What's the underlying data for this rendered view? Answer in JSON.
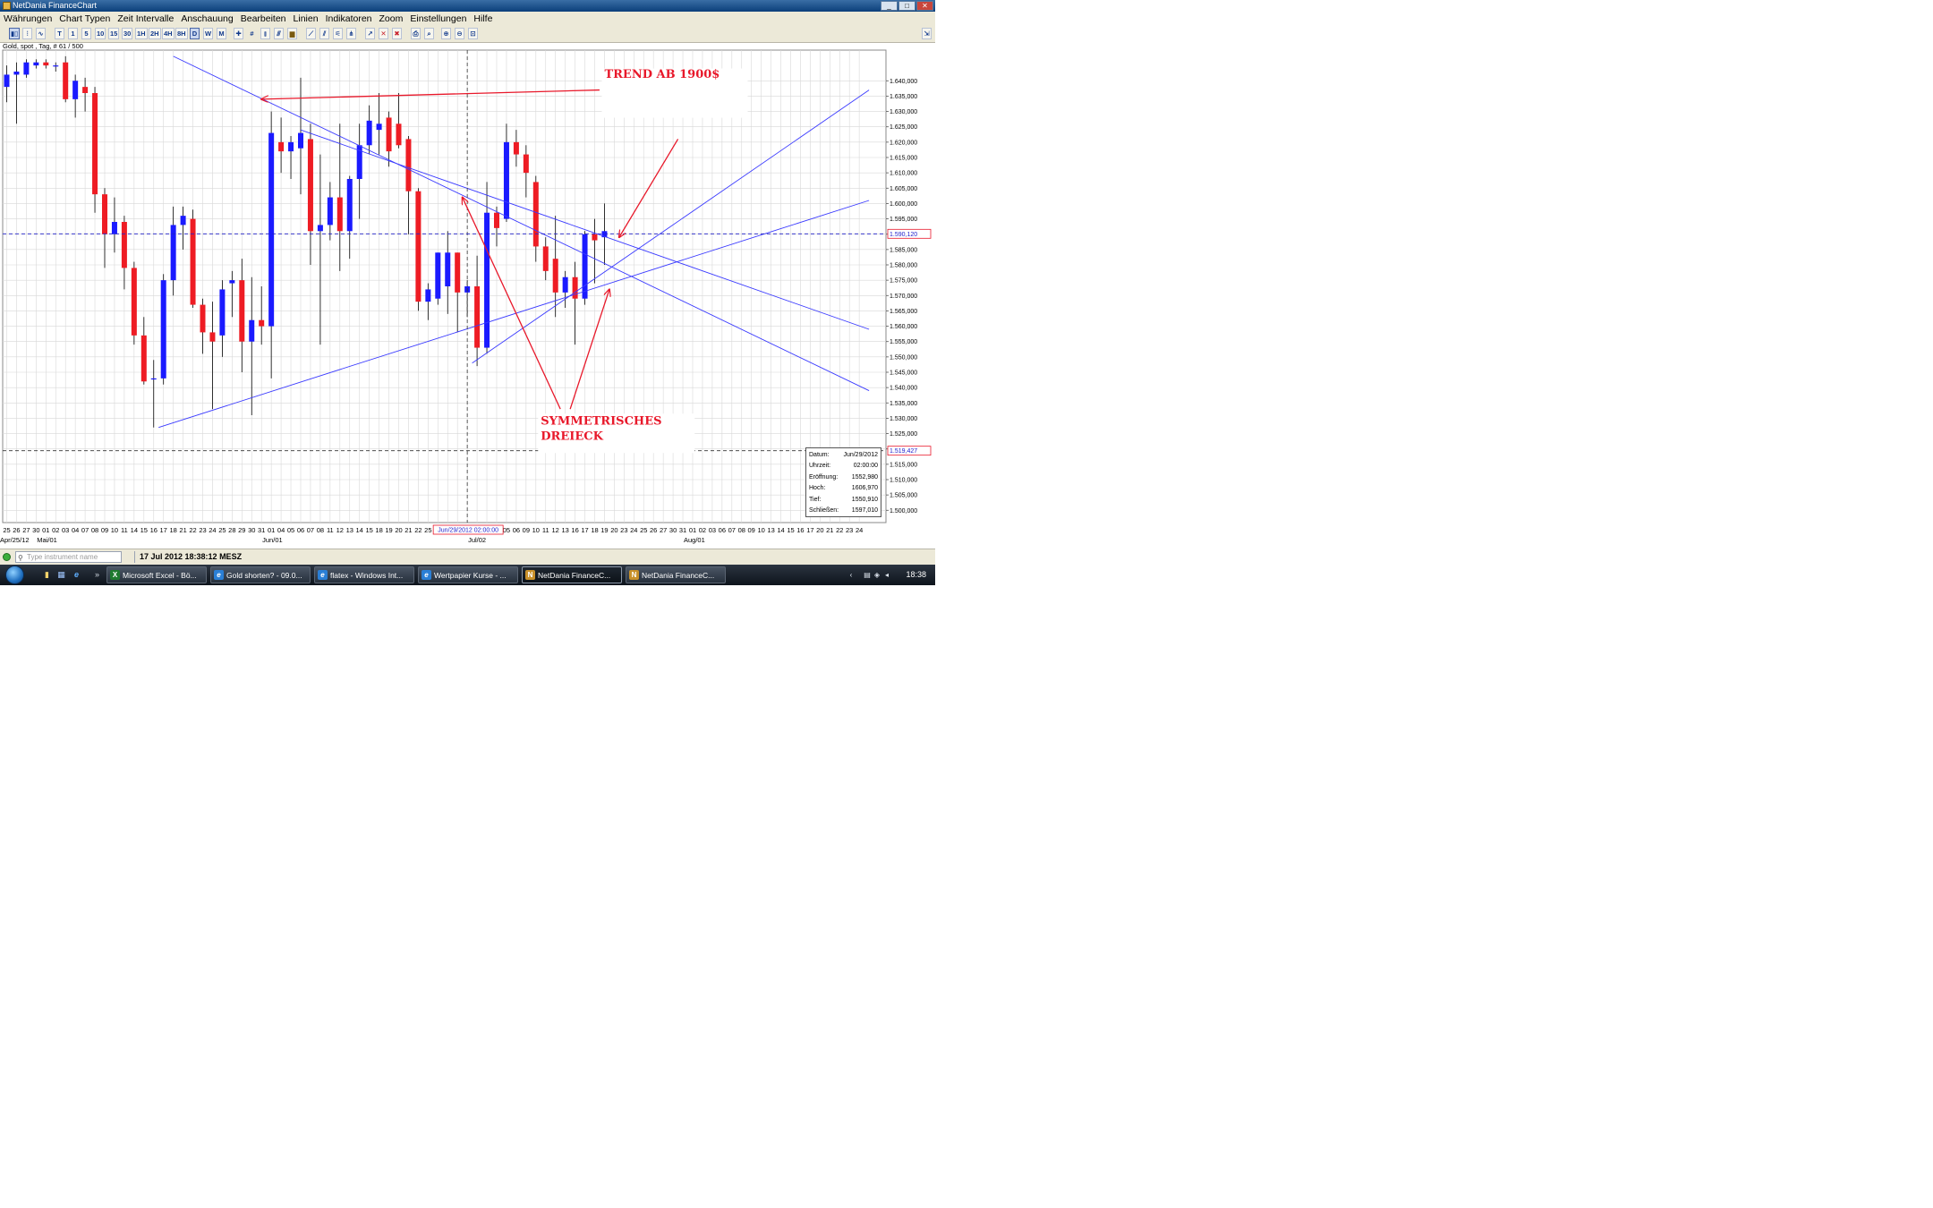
{
  "window": {
    "title": "NetDania FinanceChart",
    "buttons": [
      "_",
      "□",
      "✕"
    ]
  },
  "menu": [
    "Währungen",
    "Chart Typen",
    "Zeit Intervalle",
    "Anschauung",
    "Bearbeiten",
    "Linien",
    "Indikatoren",
    "Zoom",
    "Einstellungen",
    "Hilfe"
  ],
  "toolbar": {
    "intervals": [
      "T",
      "1",
      "5",
      "10",
      "15",
      "30",
      "1H",
      "2H",
      "4H",
      "8H",
      "D",
      "W",
      "M"
    ],
    "selected_interval": "D"
  },
  "instrument": {
    "label": "Gold, spot , Tag, # 61 / 500"
  },
  "chart_data": {
    "type": "candlestick",
    "ylim": [
      1496,
      1650
    ],
    "y_ticks": [
      "1.640,000",
      "1.635,000",
      "1.630,000",
      "1.625,000",
      "1.620,000",
      "1.615,000",
      "1.610,000",
      "1.605,000",
      "1.600,000",
      "1.595,000",
      "1.590,000",
      "1.585,000",
      "1.580,000",
      "1.575,000",
      "1.570,000",
      "1.565,000",
      "1.560,000",
      "1.555,000",
      "1.550,000",
      "1.545,000",
      "1.540,000",
      "1.535,000",
      "1.530,000",
      "1.525,000",
      "1.520,000",
      "1.515,000",
      "1.510,000",
      "1.505,000",
      "1.500,000"
    ],
    "x_day_labels": [
      "25",
      "26",
      "27",
      "30",
      "01",
      "02",
      "03",
      "04",
      "07",
      "08",
      "09",
      "10",
      "11",
      "14",
      "15",
      "16",
      "17",
      "18",
      "21",
      "22",
      "23",
      "24",
      "25",
      "28",
      "29",
      "30",
      "31",
      "01",
      "04",
      "05",
      "06",
      "07",
      "08",
      "11",
      "12",
      "13",
      "14",
      "15",
      "18",
      "19",
      "20",
      "21",
      "22",
      "25",
      "26",
      "27",
      "28",
      "29",
      "02",
      "03",
      "04",
      "05",
      "06",
      "09",
      "10",
      "11",
      "12",
      "13",
      "16",
      "17",
      "18",
      "19",
      "20",
      "23",
      "24",
      "25",
      "26",
      "27",
      "30",
      "31",
      "01",
      "02",
      "03",
      "06",
      "07",
      "08",
      "09",
      "10",
      "13",
      "14",
      "15",
      "16",
      "17",
      "20",
      "21",
      "22",
      "23",
      "24"
    ],
    "month_labels": [
      {
        "label": "Apr/25/12",
        "index": 0
      },
      {
        "label": "Mai/01",
        "index": 4
      },
      {
        "label": "Jun/01",
        "index": 27
      },
      {
        "label": "Jul/02",
        "index": 48
      },
      {
        "label": "Aug/01",
        "index": 70
      }
    ],
    "crosshair": {
      "x_label": "Jun/29/2012 02:00:00",
      "y_label": "1.519,427",
      "index": 47,
      "y": 1519.427
    },
    "last_price": {
      "label": "1.590,120",
      "y": 1590.12
    },
    "candles": [
      {
        "o": 1638,
        "h": 1645,
        "l": 1633,
        "c": 1642
      },
      {
        "o": 1642,
        "h": 1646,
        "l": 1626,
        "c": 1643
      },
      {
        "o": 1642,
        "h": 1647,
        "l": 1641,
        "c": 1646
      },
      {
        "o": 1645,
        "h": 1647,
        "l": 1644,
        "c": 1646
      },
      {
        "o": 1646,
        "h": 1647,
        "l": 1644,
        "c": 1645
      },
      {
        "o": 1645,
        "h": 1646,
        "l": 1643,
        "c": 1645
      },
      {
        "o": 1646,
        "h": 1648,
        "l": 1633,
        "c": 1634
      },
      {
        "o": 1634,
        "h": 1642,
        "l": 1628,
        "c": 1640
      },
      {
        "o": 1638,
        "h": 1641,
        "l": 1630,
        "c": 1636
      },
      {
        "o": 1636,
        "h": 1638,
        "l": 1597,
        "c": 1603
      },
      {
        "o": 1603,
        "h": 1605,
        "l": 1579,
        "c": 1590
      },
      {
        "o": 1590,
        "h": 1602,
        "l": 1584,
        "c": 1594
      },
      {
        "o": 1594,
        "h": 1596,
        "l": 1572,
        "c": 1579
      },
      {
        "o": 1579,
        "h": 1581,
        "l": 1554,
        "c": 1557
      },
      {
        "o": 1557,
        "h": 1563,
        "l": 1541,
        "c": 1542
      },
      {
        "o": 1543,
        "h": 1549,
        "l": 1527,
        "c": 1543
      },
      {
        "o": 1543,
        "h": 1577,
        "l": 1541,
        "c": 1575
      },
      {
        "o": 1575,
        "h": 1599,
        "l": 1570,
        "c": 1593
      },
      {
        "o": 1593,
        "h": 1599,
        "l": 1585,
        "c": 1596
      },
      {
        "o": 1595,
        "h": 1598,
        "l": 1566,
        "c": 1567
      },
      {
        "o": 1567,
        "h": 1569,
        "l": 1551,
        "c": 1558
      },
      {
        "o": 1558,
        "h": 1568,
        "l": 1533,
        "c": 1555
      },
      {
        "o": 1557,
        "h": 1575,
        "l": 1550,
        "c": 1572
      },
      {
        "o": 1574,
        "h": 1578,
        "l": 1563,
        "c": 1575
      },
      {
        "o": 1575,
        "h": 1582,
        "l": 1545,
        "c": 1555
      },
      {
        "o": 1555,
        "h": 1576,
        "l": 1531,
        "c": 1562
      },
      {
        "o": 1562,
        "h": 1573,
        "l": 1554,
        "c": 1560
      },
      {
        "o": 1560,
        "h": 1630,
        "l": 1543,
        "c": 1623
      },
      {
        "o": 1620,
        "h": 1628,
        "l": 1610,
        "c": 1617
      },
      {
        "o": 1617,
        "h": 1622,
        "l": 1608,
        "c": 1620
      },
      {
        "o": 1618,
        "h": 1641,
        "l": 1603,
        "c": 1623
      },
      {
        "o": 1621,
        "h": 1626,
        "l": 1580,
        "c": 1591
      },
      {
        "o": 1591,
        "h": 1616,
        "l": 1554,
        "c": 1593
      },
      {
        "o": 1593,
        "h": 1607,
        "l": 1588,
        "c": 1602
      },
      {
        "o": 1602,
        "h": 1626,
        "l": 1578,
        "c": 1591
      },
      {
        "o": 1591,
        "h": 1609,
        "l": 1582,
        "c": 1608
      },
      {
        "o": 1608,
        "h": 1626,
        "l": 1595,
        "c": 1619
      },
      {
        "o": 1619,
        "h": 1632,
        "l": 1616,
        "c": 1627
      },
      {
        "o": 1624,
        "h": 1636,
        "l": 1616,
        "c": 1626
      },
      {
        "o": 1628,
        "h": 1630,
        "l": 1612,
        "c": 1617
      },
      {
        "o": 1626,
        "h": 1636,
        "l": 1618,
        "c": 1619
      },
      {
        "o": 1621,
        "h": 1622,
        "l": 1590,
        "c": 1604
      },
      {
        "o": 1604,
        "h": 1605,
        "l": 1565,
        "c": 1568
      },
      {
        "o": 1568,
        "h": 1574,
        "l": 1562,
        "c": 1572
      },
      {
        "o": 1569,
        "h": 1576,
        "l": 1567,
        "c": 1584
      },
      {
        "o": 1573,
        "h": 1591,
        "l": 1564,
        "c": 1584
      },
      {
        "o": 1584,
        "h": 1576,
        "l": 1558,
        "c": 1571
      },
      {
        "o": 1571,
        "h": 1575,
        "l": 1563,
        "c": 1573
      },
      {
        "o": 1573,
        "h": 1583,
        "l": 1547,
        "c": 1553
      },
      {
        "o": 1553,
        "h": 1607,
        "l": 1551,
        "c": 1597
      },
      {
        "o": 1597,
        "h": 1599,
        "l": 1586,
        "c": 1592
      },
      {
        "o": 1595,
        "h": 1626,
        "l": 1594,
        "c": 1620
      },
      {
        "o": 1620,
        "h": 1624,
        "l": 1612,
        "c": 1616
      },
      {
        "o": 1616,
        "h": 1619,
        "l": 1602,
        "c": 1610
      },
      {
        "o": 1607,
        "h": 1609,
        "l": 1581,
        "c": 1586
      },
      {
        "o": 1586,
        "h": 1589,
        "l": 1575,
        "c": 1578
      },
      {
        "o": 1582,
        "h": 1596,
        "l": 1563,
        "c": 1571
      },
      {
        "o": 1571,
        "h": 1578,
        "l": 1566,
        "c": 1576
      },
      {
        "o": 1576,
        "h": 1581,
        "l": 1554,
        "c": 1569
      },
      {
        "o": 1569,
        "h": 1591,
        "l": 1567,
        "c": 1590
      },
      {
        "o": 1590,
        "h": 1595,
        "l": 1574,
        "c": 1588
      },
      {
        "o": 1589,
        "h": 1600,
        "l": 1580,
        "c": 1591
      }
    ],
    "trendlines_blue": [
      {
        "i1": 15.5,
        "y1": 1527,
        "i2": 88,
        "y2": 1601
      },
      {
        "i1": 17,
        "y1": 1648,
        "i2": 88,
        "y2": 1539
      },
      {
        "i1": 30,
        "y1": 1624,
        "i2": 88,
        "y2": 1559
      },
      {
        "i1": 47.5,
        "y1": 1548,
        "i2": 88,
        "y2": 1637
      }
    ],
    "annotations": [
      {
        "text": "TREND AB 1900$",
        "i": 61,
        "y": 1641
      },
      {
        "text": "SYMMETRISCHES",
        "i": 54.5,
        "y": 1528
      },
      {
        "text": "DREIECK",
        "i": 54.5,
        "y": 1523
      }
    ],
    "arrows_red": [
      {
        "i1": 60.5,
        "y1": 1637,
        "i2": 26,
        "y2": 1634
      },
      {
        "i1": 68.5,
        "y1": 1621,
        "i2": 62.5,
        "y2": 1589
      },
      {
        "i1": 56.5,
        "y1": 1533,
        "i2": 46.5,
        "y2": 1602
      },
      {
        "i1": 57.5,
        "y1": 1533,
        "i2": 61.5,
        "y2": 1572
      }
    ],
    "grid": true
  },
  "infobox": {
    "rows": [
      {
        "k": "Datum:",
        "v": "Jun/29/2012"
      },
      {
        "k": "Uhrzeit:",
        "v": "02:00:00"
      },
      {
        "k": "Eröffnung:",
        "v": "1552,980"
      },
      {
        "k": "Hoch:",
        "v": "1606,970"
      },
      {
        "k": "Tief:",
        "v": "1550,910"
      },
      {
        "k": "Schließen:",
        "v": "1597,010"
      }
    ]
  },
  "statusbar": {
    "search_placeholder": "Type instrument name",
    "datetime": "17 Jul 2012 18:38:12 MESZ"
  },
  "taskbar": {
    "tasks": [
      {
        "label": "Microsoft Excel - Bö...",
        "icon": "excel-icon",
        "color": "#1e7a2e",
        "glyph": "X"
      },
      {
        "label": "Gold shorten? - 09.0...",
        "icon": "ie-icon",
        "color": "#2a7fd6",
        "glyph": "e"
      },
      {
        "label": "flatex - Windows Int...",
        "icon": "ie-icon",
        "color": "#2a7fd6",
        "glyph": "e"
      },
      {
        "label": "Wertpapier Kurse - ...",
        "icon": "ie-icon",
        "color": "#2a7fd6",
        "glyph": "e"
      },
      {
        "label": "NetDania FinanceC...",
        "icon": "netdania-icon",
        "color": "#c8902a",
        "glyph": "N"
      },
      {
        "label": "NetDania FinanceC...",
        "icon": "netdania-icon",
        "color": "#c8902a",
        "glyph": "N"
      }
    ],
    "clock": "18:38"
  },
  "colors": {
    "up": "#1a1aff",
    "down": "#ee1c24",
    "trend": "#3a3aff",
    "annot": "#e8182a",
    "grid": "#d8d8d8"
  }
}
